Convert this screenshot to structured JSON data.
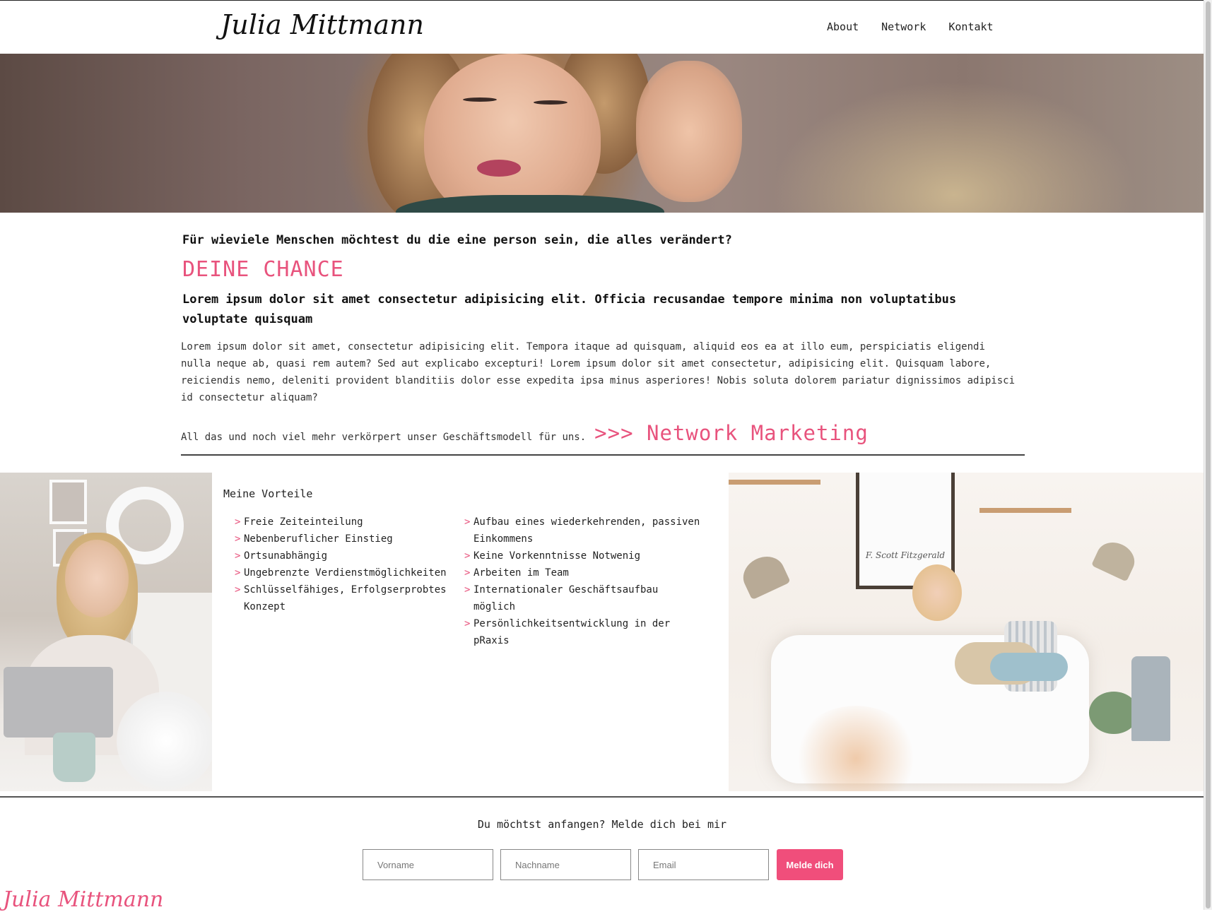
{
  "header": {
    "logo": "Julia Mittmann",
    "nav": [
      "About",
      "Network",
      "Kontakt"
    ]
  },
  "main": {
    "question": "Für wieviele Menschen möchtest du die eine person sein, die alles verändert?",
    "chance_heading": "DEINE CHANCE",
    "lead": "Lorem ipsum dolor sit amet consectetur adipisicing elit. Officia recusandae tempore minima non voluptatibus voluptate quisquam",
    "body": "Lorem ipsum dolor sit amet, consectetur adipisicing elit. Tempora itaque ad quisquam, aliquid eos ea at illo eum, perspiciatis eligendi nulla neque ab, quasi rem autem? Sed aut explicabo excepturi! Lorem ipsum dolor sit amet consectetur, adipisicing elit. Quisquam labore, reiciendis nemo, deleniti provident blanditiis dolor esse expedita ipsa minus asperiores! Nobis soluta dolorem pariatur dignissimos adipisci id consectetur aliquam?",
    "cta_text": "All das und noch viel mehr verkörpert unser Geschäftsmodell für uns.",
    "cta_link": ">>> Network Marketing"
  },
  "features": {
    "title": "Meine Vorteile",
    "marker": ">",
    "left": [
      "Freie Zeiteinteilung",
      "Nebenberuflicher Einstieg",
      "Ortsunabhängig",
      "Ungebrenzte Verdienstmöglichkeiten",
      "Schlüsselfähiges, Erfolgserprobtes Konzept"
    ],
    "right": [
      "Aufbau eines wiederkehrenden, passiven Einkommens",
      "Keine Vorkenntnisse Notwenig",
      "Arbeiten im Team",
      "Internationaler Geschäftsaufbau möglich",
      "Persönlichkeitsentwicklung in der pRaxis"
    ],
    "poster_text": "F. Scott Fitzgerald"
  },
  "signup": {
    "text": "Du möchtst anfangen? Melde dich bei mir",
    "vorname_placeholder": "Vorname",
    "nachname_placeholder": "Nachname",
    "email_placeholder": "Email",
    "button": "Melde dich"
  },
  "footer": {
    "logo": "Julia Mittmann"
  },
  "colors": {
    "accent": "#e8537d",
    "button": "#f04e7b"
  }
}
